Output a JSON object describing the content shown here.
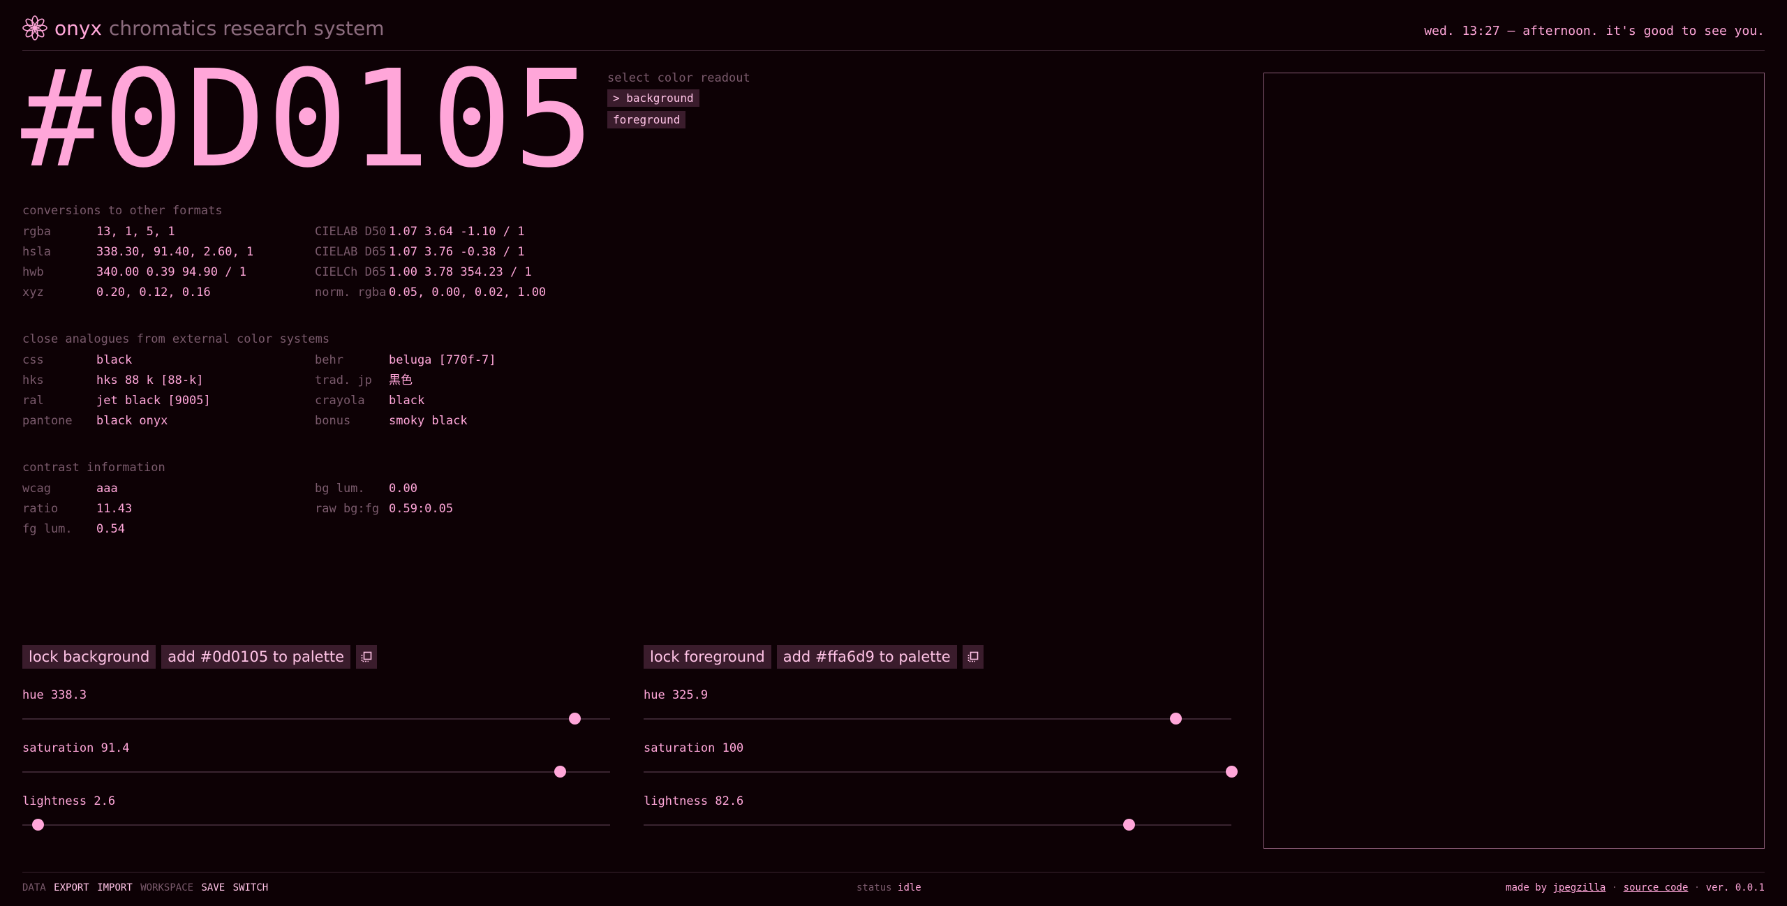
{
  "header": {
    "brand": "onyx",
    "subtitle": "chromatics research system",
    "greeting": "wed. 13:27 — afternoon. it's good to see you."
  },
  "hex": "#0D0105",
  "readout": {
    "label": "select color readout",
    "options": [
      "> background",
      "foreground"
    ]
  },
  "conversions": {
    "title": "conversions to other formats",
    "left": [
      {
        "k": "rgba",
        "v": "13, 1, 5, 1"
      },
      {
        "k": "hsla",
        "v": "338.30, 91.40, 2.60, 1"
      },
      {
        "k": "hwb",
        "v": "340.00 0.39 94.90 / 1"
      },
      {
        "k": "xyz",
        "v": "0.20, 0.12, 0.16"
      }
    ],
    "right": [
      {
        "k": "CIELAB D50",
        "v": "1.07 3.64 -1.10 / 1"
      },
      {
        "k": "CIELAB D65",
        "v": "1.07 3.76 -0.38 / 1"
      },
      {
        "k": "CIELCh D65",
        "v": "1.00 3.78 354.23 / 1"
      },
      {
        "k": "norm. rgba",
        "v": "0.05, 0.00, 0.02, 1.00"
      }
    ]
  },
  "analogues": {
    "title": "close analogues from external color systems",
    "left": [
      {
        "k": "css",
        "v": "black"
      },
      {
        "k": "hks",
        "v": "hks 88 k [88-k]"
      },
      {
        "k": "ral",
        "v": "jet black [9005]"
      },
      {
        "k": "pantone",
        "v": "black onyx"
      }
    ],
    "right": [
      {
        "k": "behr",
        "v": "beluga [770f-7]"
      },
      {
        "k": "trad. jp",
        "v": "黒色"
      },
      {
        "k": "crayola",
        "v": "black"
      },
      {
        "k": "bonus",
        "v": "smoky black"
      }
    ]
  },
  "contrast": {
    "title": "contrast information",
    "left": [
      {
        "k": "wcag",
        "v": "aaa"
      },
      {
        "k": "ratio",
        "v": "11.43"
      },
      {
        "k": "fg lum.",
        "v": "0.54"
      }
    ],
    "right": [
      {
        "k": "bg lum.",
        "v": "0.00"
      },
      {
        "k": "raw bg:fg",
        "v": "0.59:0.05"
      }
    ]
  },
  "background_controls": {
    "lock": "lock background",
    "add": "add #0d0105 to palette",
    "copy_icon": "copy-icon",
    "sliders": [
      {
        "label": "hue 338.3",
        "value": 338.3,
        "max": 360
      },
      {
        "label": "saturation 91.4",
        "value": 91.4,
        "max": 100
      },
      {
        "label": "lightness 2.6",
        "value": 2.6,
        "max": 100
      }
    ]
  },
  "foreground_controls": {
    "lock": "lock foreground",
    "add": "add #ffa6d9 to palette",
    "copy_icon": "copy-icon",
    "sliders": [
      {
        "label": "hue 325.9",
        "value": 325.9,
        "max": 360
      },
      {
        "label": "saturation 100",
        "value": 100,
        "max": 100
      },
      {
        "label": "lightness 82.6",
        "value": 82.6,
        "max": 100
      }
    ]
  },
  "footer": {
    "data": "DATA",
    "export": "EXPORT",
    "import": "IMPORT",
    "workspace": "WORKSPACE",
    "save": "SAVE",
    "switch": "SWITCH",
    "status_label": "status",
    "status_value": "idle",
    "made_by": "made by",
    "author": "jpegzilla",
    "sep": "·",
    "source": "source code",
    "version": "ver. 0.0.1"
  },
  "colors": {
    "background": "#0d0105",
    "foreground": "#ffa6d9",
    "button_bg": "#3a1c2c",
    "muted": "#7a5a6c"
  }
}
